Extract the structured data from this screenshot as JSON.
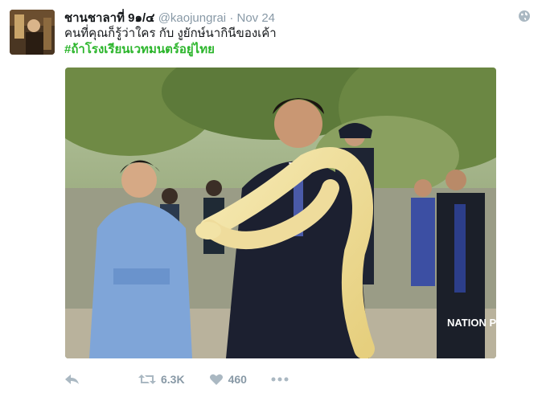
{
  "tweet": {
    "display_name": "ชานชาลาที่ 9๑/๔",
    "handle": "@kaojungrai",
    "separator": "·",
    "time": "Nov 24",
    "text": "คนที่คุณก็รู้ว่าใคร กับ งูยักษ์นากินีของเค้า",
    "hashtag": "#ถ้าโรงเรียนเวทมนตร์อยู่ไทย",
    "media_watermark": "NATION PHOTO"
  },
  "actions": {
    "retweets": "6.3K",
    "likes": "460"
  },
  "icons": [
    "reply-icon",
    "retweet-icon",
    "like-icon",
    "more-icon",
    "globe-icon"
  ],
  "colors": {
    "name": "#14171a",
    "secondary": "#8899a6",
    "hashtag": "#2bb52b"
  }
}
